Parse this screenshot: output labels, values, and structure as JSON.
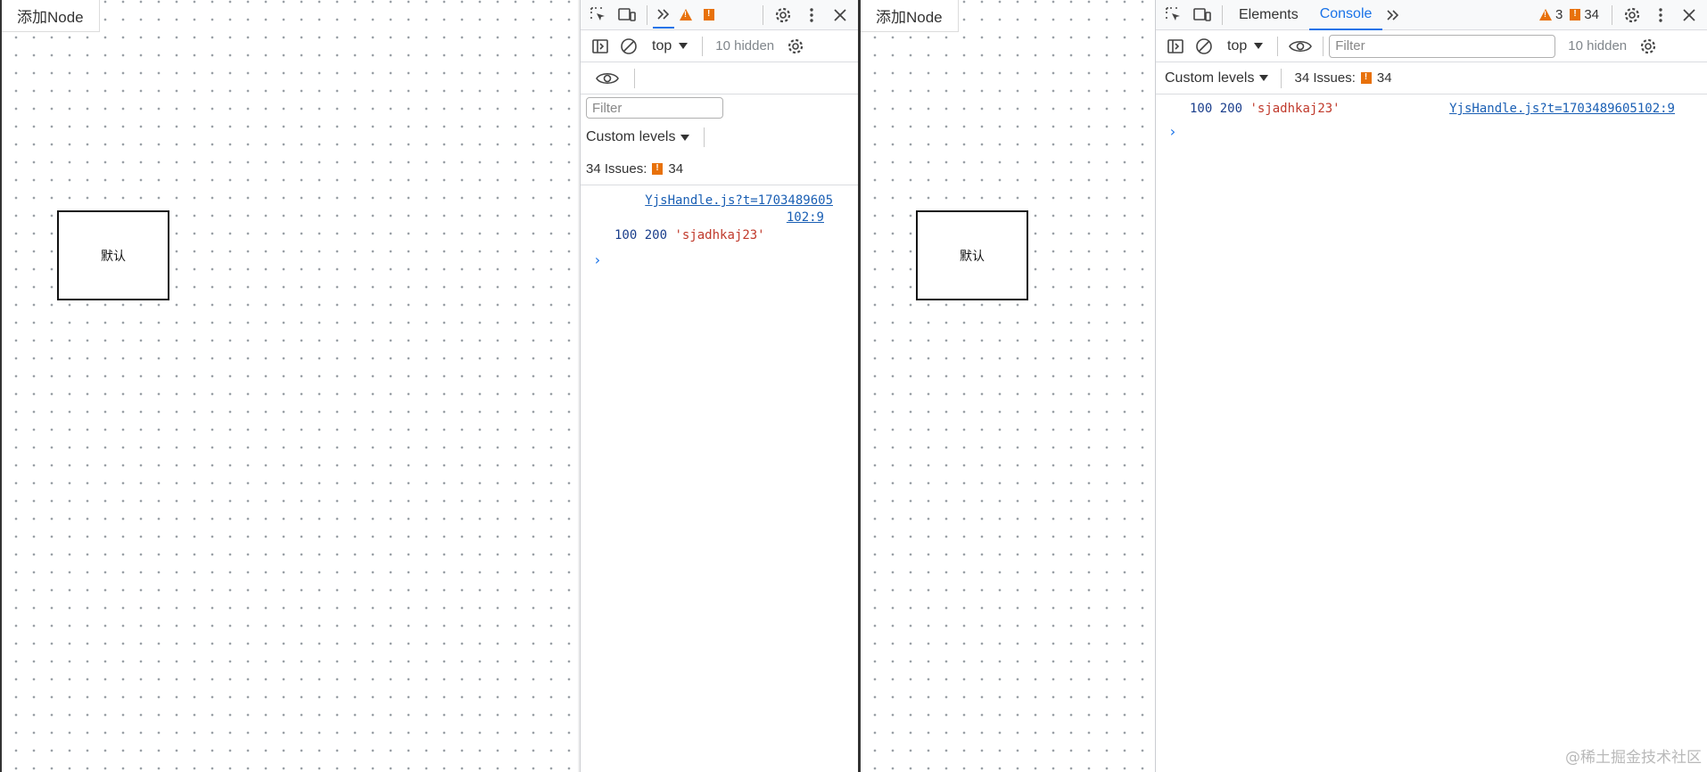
{
  "app": {
    "add_node_label": "添加Node",
    "node_label": "默认"
  },
  "devtools_left": {
    "context": "top",
    "hidden": "10 hidden",
    "filter_placeholder": "Filter",
    "levels": "Custom levels",
    "issues_label": "34 Issues:",
    "issues_count": "34",
    "log": {
      "source_line1": "YjsHandle.js?t=1703489605",
      "source_line2": "102:9",
      "num1": "100",
      "num2": "200",
      "str": "'sjadhkaj23'"
    }
  },
  "devtools_right": {
    "tabs": [
      "Elements",
      "Console"
    ],
    "active_tab": "Console",
    "warnings_count": "3",
    "issues_badge_count": "34",
    "context": "top",
    "hidden": "10 hidden",
    "filter_placeholder": "Filter",
    "levels": "Custom levels",
    "issues_label": "34 Issues:",
    "issues_count": "34",
    "log": {
      "num1": "100",
      "num2": "200",
      "str": "'sjadhkaj23'",
      "source": "YjsHandle.js?t=1703489605102:9"
    }
  },
  "prompt_symbol": "›",
  "watermark": "@稀土掘金技术社区",
  "colors": {
    "accent": "#1a73e8",
    "warning": "#e8710a",
    "string": "#c0392b",
    "number": "#1a3e8c"
  }
}
